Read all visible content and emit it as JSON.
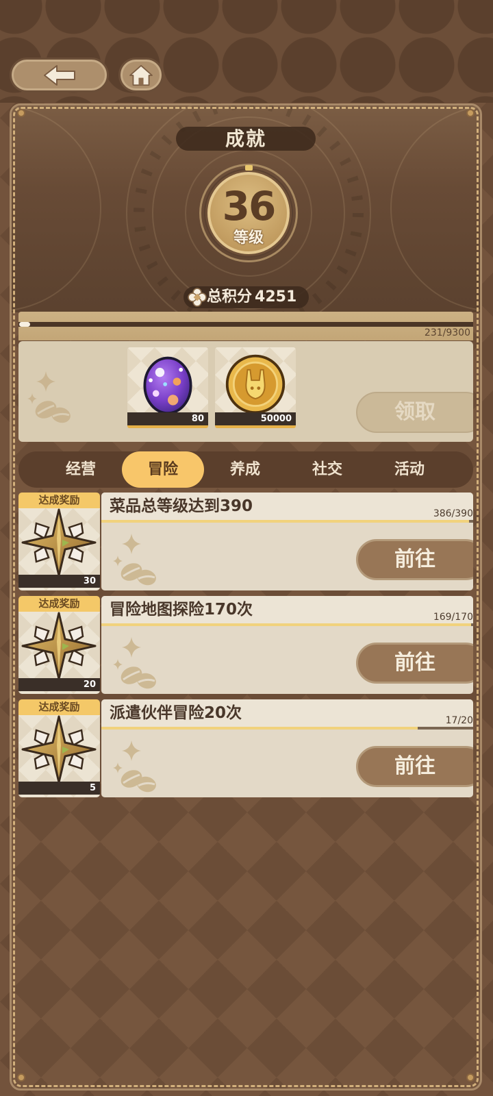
{
  "nav": {
    "back_icon": "arrow-left-icon",
    "home_icon": "home-icon"
  },
  "header": {
    "title": "成就",
    "level": "36",
    "level_label": "等级",
    "points_icon": "clover-icon",
    "points_label": "总积分",
    "points_value": "4251"
  },
  "progress": {
    "text": "231/9300",
    "current": 231,
    "total": 9300
  },
  "rewards": {
    "decor_icon": "coffee-beans-sparkle-icon",
    "items": [
      {
        "icon": "purple-egg-icon",
        "count": "80"
      },
      {
        "icon": "gold-coin-icon",
        "count": "50000"
      }
    ],
    "claim_label": "领取",
    "claim_enabled": false
  },
  "tabs": [
    {
      "label": "经营",
      "active": false
    },
    {
      "label": "冒险",
      "active": true
    },
    {
      "label": "养成",
      "active": false
    },
    {
      "label": "社交",
      "active": false
    },
    {
      "label": "活动",
      "active": false
    }
  ],
  "achievements": [
    {
      "badge": "达成奖励",
      "reward_icon": "compass-star-icon",
      "reward_count": "30",
      "title": "菜品总等级达到390",
      "progress_text": "386/390",
      "current": 386,
      "total": 390,
      "button": "前往"
    },
    {
      "badge": "达成奖励",
      "reward_icon": "compass-star-icon",
      "reward_count": "20",
      "title": "冒险地图探险170次",
      "progress_text": "169/170",
      "current": 169,
      "total": 170,
      "button": "前往"
    },
    {
      "badge": "达成奖励",
      "reward_icon": "compass-star-icon",
      "reward_count": "5",
      "title": "派遣伙伴冒险20次",
      "progress_text": "17/20",
      "current": 17,
      "total": 20,
      "button": "前往"
    }
  ],
  "colors": {
    "active_tab": "#f8c66a",
    "badge": "#f4c868",
    "progress_fill": "#f1d27c",
    "button": "#987656",
    "panel_border": "#d2b07c"
  }
}
